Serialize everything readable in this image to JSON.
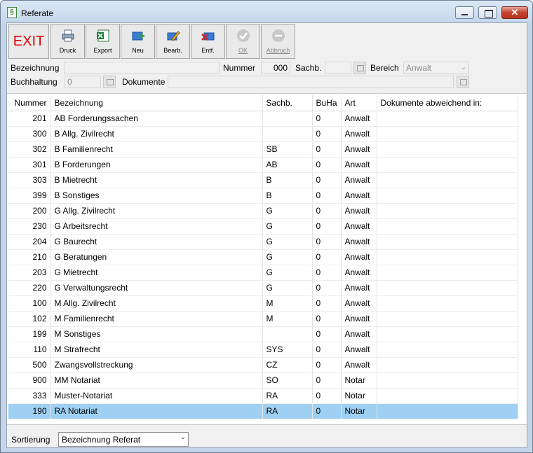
{
  "window": {
    "title": "Referate"
  },
  "toolbar": {
    "exit": "EXIT",
    "druck": "Druck",
    "export": "Export",
    "neu": "Neu",
    "bearb": "Bearb.",
    "entf": "Entf.",
    "ok": "OK",
    "abbruch": "Abbruch"
  },
  "form": {
    "bezeichnung_label": "Bezeichnung",
    "bezeichnung_value": "",
    "nummer_label": "Nummer",
    "nummer_value": "000",
    "sachb_label": "Sachb.",
    "sachb_value": "",
    "bereich_label": "Bereich",
    "bereich_value": "Anwalt",
    "buchhaltung_label": "Buchhaltung",
    "buchhaltung_value": "0",
    "dokumente_label": "Dokumente",
    "dokumente_value": ""
  },
  "table": {
    "headers": [
      "Nummer",
      "Bezeichnung",
      "Sachb.",
      "BuHa",
      "Art",
      "Dokumente abweichend in:"
    ],
    "rows": [
      {
        "nummer": "201",
        "bezeichnung": "AB Forderungssachen",
        "sachb": "",
        "buha": "0",
        "art": "Anwalt",
        "dokumente": ""
      },
      {
        "nummer": "300",
        "bezeichnung": "B Allg. Zivilrecht",
        "sachb": "",
        "buha": "0",
        "art": "Anwalt",
        "dokumente": ""
      },
      {
        "nummer": "302",
        "bezeichnung": "B Familienrecht",
        "sachb": "SB",
        "buha": "0",
        "art": "Anwalt",
        "dokumente": ""
      },
      {
        "nummer": "301",
        "bezeichnung": "B Forderungen",
        "sachb": "AB",
        "buha": "0",
        "art": "Anwalt",
        "dokumente": ""
      },
      {
        "nummer": "303",
        "bezeichnung": "B Mietrecht",
        "sachb": "B",
        "buha": "0",
        "art": "Anwalt",
        "dokumente": ""
      },
      {
        "nummer": "399",
        "bezeichnung": "B Sonstiges",
        "sachb": "B",
        "buha": "0",
        "art": "Anwalt",
        "dokumente": ""
      },
      {
        "nummer": "200",
        "bezeichnung": "G Allg. Zivilrecht",
        "sachb": "G",
        "buha": "0",
        "art": "Anwalt",
        "dokumente": ""
      },
      {
        "nummer": "230",
        "bezeichnung": "G Arbeitsrecht",
        "sachb": "G",
        "buha": "0",
        "art": "Anwalt",
        "dokumente": ""
      },
      {
        "nummer": "204",
        "bezeichnung": "G Baurecht",
        "sachb": "G",
        "buha": "0",
        "art": "Anwalt",
        "dokumente": ""
      },
      {
        "nummer": "210",
        "bezeichnung": "G Beratungen",
        "sachb": "G",
        "buha": "0",
        "art": "Anwalt",
        "dokumente": ""
      },
      {
        "nummer": "203",
        "bezeichnung": "G Mietrecht",
        "sachb": "G",
        "buha": "0",
        "art": "Anwalt",
        "dokumente": ""
      },
      {
        "nummer": "220",
        "bezeichnung": "G Verwaltungsrecht",
        "sachb": "G",
        "buha": "0",
        "art": "Anwalt",
        "dokumente": ""
      },
      {
        "nummer": "100",
        "bezeichnung": "M Allg. Zivilrecht",
        "sachb": "M",
        "buha": "0",
        "art": "Anwalt",
        "dokumente": ""
      },
      {
        "nummer": "102",
        "bezeichnung": "M Familienrecht",
        "sachb": "M",
        "buha": "0",
        "art": "Anwalt",
        "dokumente": ""
      },
      {
        "nummer": "199",
        "bezeichnung": "M Sonstiges",
        "sachb": "",
        "buha": "0",
        "art": "Anwalt",
        "dokumente": ""
      },
      {
        "nummer": "110",
        "bezeichnung": "M Strafrecht",
        "sachb": "SYS",
        "buha": "0",
        "art": "Anwalt",
        "dokumente": ""
      },
      {
        "nummer": "500",
        "bezeichnung": "Zwangsvollstreckung",
        "sachb": "CZ",
        "buha": "0",
        "art": "Anwalt",
        "dokumente": ""
      },
      {
        "nummer": "900",
        "bezeichnung": "MM Notariat",
        "sachb": "SO",
        "buha": "0",
        "art": "Notar",
        "dokumente": ""
      },
      {
        "nummer": "333",
        "bezeichnung": "Muster-Notariat",
        "sachb": "RA",
        "buha": "0",
        "art": "Notar",
        "dokumente": ""
      },
      {
        "nummer": "190",
        "bezeichnung": "RA Notariat",
        "sachb": "RA",
        "buha": "0",
        "art": "Notar",
        "dokumente": "",
        "selected": true
      }
    ]
  },
  "footer": {
    "sortierung_label": "Sortierung",
    "sortierung_value": "Bezeichnung Referat"
  },
  "colors": {
    "exit_text": "#e10000",
    "selected_row": "#9dd0f2",
    "titlebar": "#c4d5ea"
  },
  "icons": {
    "title": "paragraph-app-icon",
    "druck": "printer-icon",
    "export": "excel-export-icon",
    "neu": "new-record-icon",
    "bearb": "edit-pencil-icon",
    "entf": "delete-icon",
    "ok": "check-icon",
    "abbruch": "cancel-icon"
  }
}
